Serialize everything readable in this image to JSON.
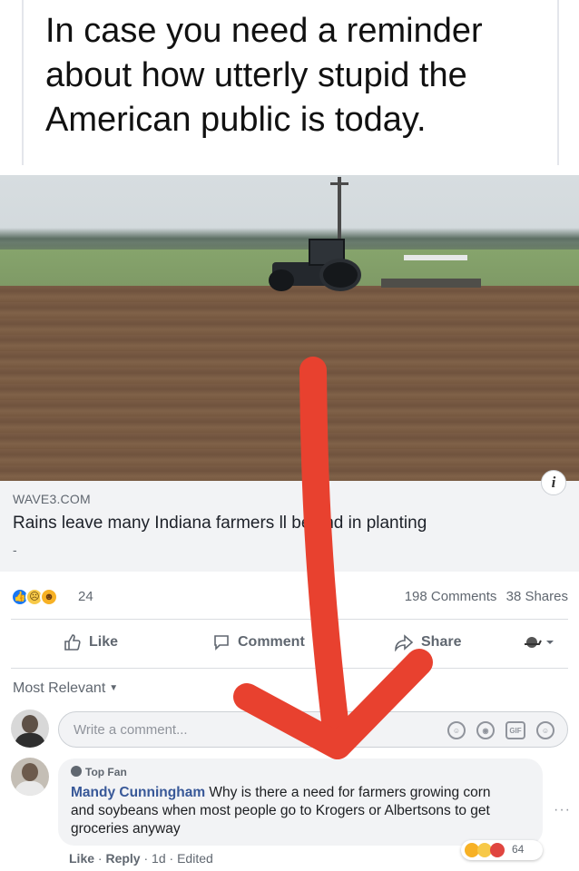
{
  "caption": {
    "text": "In case you need a reminder about how utterly stupid the American public is today."
  },
  "link_preview": {
    "domain": "WAVE3.COM",
    "headline": "Rains leave many Indiana farmers     ll behind in planting",
    "dash": "-",
    "info_icon": "i"
  },
  "stats": {
    "reaction_count": "24",
    "comments": "198 Comments",
    "shares": "38 Shares",
    "reaction_icons": [
      "like-icon",
      "sad-icon",
      "haha-icon"
    ]
  },
  "actions": {
    "like_label": "Like",
    "comment_label": "Comment",
    "share_label": "Share"
  },
  "sort": {
    "label": "Most Relevant"
  },
  "composer": {
    "placeholder": "Write a comment..."
  },
  "comment": {
    "badge": "Top Fan",
    "author": "Mandy Cunningham",
    "text": " Why is there a need for farmers growing corn and soybeans when most people go to Krogers or Albertsons to get groceries anyway",
    "reaction_count": "64",
    "meta": {
      "like": "Like",
      "reply": "Reply",
      "time": "1d",
      "edited": "Edited",
      "sep": " · "
    }
  },
  "colors": {
    "arrow": "#e8412f",
    "link_blue": "#385898",
    "like_blue": "#1877f2"
  }
}
